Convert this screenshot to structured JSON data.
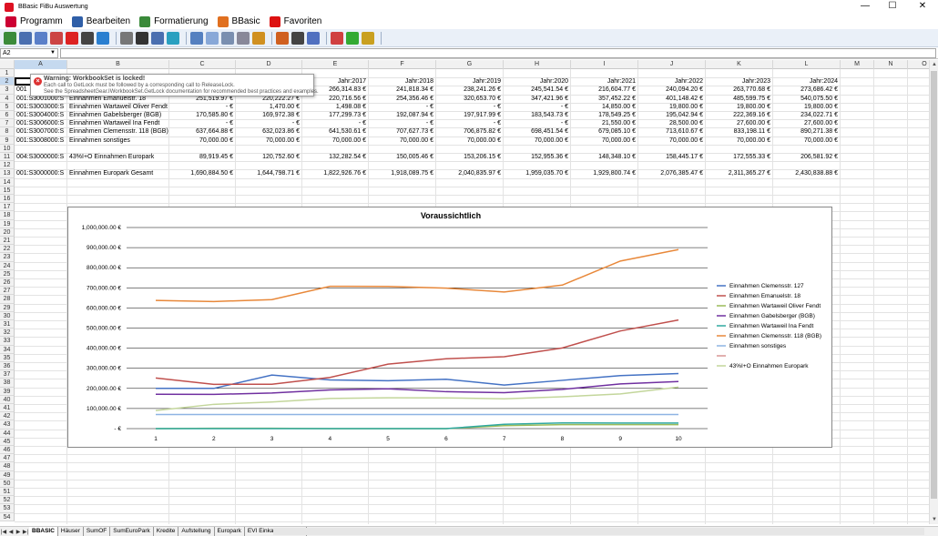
{
  "window": {
    "title": "BBasic FiBu Auswertung",
    "minimize": "—",
    "maximize": "☐",
    "close": "✕"
  },
  "menu": [
    {
      "label": "Programm",
      "icon": "programm-icon",
      "color": "#c03"
    },
    {
      "label": "Bearbeiten",
      "icon": "edit-icon",
      "color": "#2f5fa8"
    },
    {
      "label": "Formatierung",
      "icon": "format-icon",
      "color": "#3a8a3a"
    },
    {
      "label": "BBasic",
      "icon": "bbasic-icon",
      "color": "#e07020"
    },
    {
      "label": "Favoriten",
      "icon": "star-icon",
      "color": "#d11"
    }
  ],
  "formula": {
    "namebox": "A2",
    "value": ""
  },
  "columns": [
    "A",
    "B",
    "C",
    "D",
    "E",
    "F",
    "G",
    "H",
    "I",
    "J",
    "K",
    "L",
    "M",
    "N",
    "O"
  ],
  "rows": [
    "1",
    "2",
    "3",
    "4",
    "5",
    "6",
    "7",
    "8",
    "9",
    "10",
    "11",
    "12",
    "13",
    "14",
    "15",
    "16",
    "17",
    "18",
    "19",
    "20",
    "21",
    "22",
    "23",
    "24",
    "25",
    "26",
    "27",
    "28",
    "29",
    "30",
    "31",
    "32",
    "33",
    "34",
    "35",
    "36",
    "37",
    "38",
    "39",
    "40",
    "41",
    "42",
    "43",
    "44",
    "45",
    "46",
    "47",
    "48",
    "49",
    "50",
    "51",
    "52",
    "53",
    "54"
  ],
  "header_row": {
    "E": "Jahr:2017",
    "F": "Jahr:2018",
    "G": "Jahr:2019",
    "H": "Jahr:2020",
    "I": "Jahr:2021",
    "J": "Jahr:2022",
    "K": "Jahr:2023",
    "L": "Jahr:2024"
  },
  "table": [
    {
      "row": 3,
      "A": "001",
      "B": "",
      "C": "",
      "D": "",
      "E": "266,314.83 €",
      "F": "241,818.34 €",
      "G": "238,241.26 €",
      "H": "245,541.54 €",
      "I": "216,604.77 €",
      "J": "240,094.20 €",
      "K": "263,770.68 €",
      "L": "273,686.42 €"
    },
    {
      "row": 4,
      "A": "001:S3001000:S",
      "B": "Einnahmen Emanuelstr. 18",
      "C": "251,519.97 €",
      "D": "220,222.27 €",
      "E": "220,716.56 €",
      "F": "254,356.46 €",
      "G": "320,653.70 €",
      "H": "347,421.96 €",
      "I": "357,452.22 €",
      "J": "401,148.42 €",
      "K": "485,599.75 €",
      "L": "540,075.50 €"
    },
    {
      "row": 5,
      "A": "001:S3003000:S",
      "B": "Einnahmen Wartaweil Oliver Fendt",
      "C": "-  €",
      "D": "1,470.00 €",
      "E": "1,498.08 €",
      "F": "-  €",
      "G": "-  €",
      "H": "-  €",
      "I": "14,850.00 €",
      "J": "19,800.00 €",
      "K": "19,800.00 €",
      "L": "19,800.00 €"
    },
    {
      "row": 6,
      "A": "001:S3004000:S",
      "B": "Einnahmen Gabelsberger (BGB)",
      "C": "170,585.80 €",
      "D": "169,972.38 €",
      "E": "177,299.73 €",
      "F": "192,087.94 €",
      "G": "197,917.99 €",
      "H": "183,543.73 €",
      "I": "178,549.25 €",
      "J": "195,042.94 €",
      "K": "222,369.16 €",
      "L": "234,022.71 €"
    },
    {
      "row": 7,
      "A": "001:S3006000:S",
      "B": "Einnahmen Wartaweil Ina Fendt",
      "C": "-  €",
      "D": "-  €",
      "E": "-  €",
      "F": "-  €",
      "G": "-  €",
      "H": "-  €",
      "I": "21,550.00 €",
      "J": "28,500.00 €",
      "K": "27,600.00 €",
      "L": "27,600.00 €"
    },
    {
      "row": 8,
      "A": "001:S3007000:S",
      "B": "Einnahmen Clemensstr. 118 (BGB)",
      "C": "637,664.88 €",
      "D": "632,023.86 €",
      "E": "641,530.61 €",
      "F": "707,627.73 €",
      "G": "706,875.82 €",
      "H": "698,451.54 €",
      "I": "679,085.10 €",
      "J": "713,610.67 €",
      "K": "833,198.11 €",
      "L": "890,271.38 €"
    },
    {
      "row": 9,
      "A": "001:S3008000:S",
      "B": "Einnahmen sonstiges",
      "C": "70,000.00 €",
      "D": "70,000.00 €",
      "E": "70,000.00 €",
      "F": "70,000.00 €",
      "G": "70,000.00 €",
      "H": "70,000.00 €",
      "I": "70,000.00 €",
      "J": "70,000.00 €",
      "K": "70,000.00 €",
      "L": "70,000.00 €"
    },
    {
      "row": 11,
      "A": "004:S3000000:S",
      "B": "43%I+O Einnahmen Europark",
      "C": "89,919.45 €",
      "D": "120,752.60 €",
      "E": "132,282.54 €",
      "F": "150,005.46 €",
      "G": "153,206.15 €",
      "H": "152,955.36 €",
      "I": "148,348.10 €",
      "J": "158,445.17 €",
      "K": "172,555.33 €",
      "L": "206,581.92 €"
    },
    {
      "row": 13,
      "A": "001:S3000000:S",
      "B": "Einnahmen Europark Gesamt",
      "C": "1,690,884.50 €",
      "D": "1,644,798.71 €",
      "E": "1,822,926.76 €",
      "F": "1,918,089.75 €",
      "G": "2,040,835.97 €",
      "H": "1,959,035.70 €",
      "I": "1,929,800.74 €",
      "J": "2,076,385.47 €",
      "K": "2,311,365.27 €",
      "L": "2,430,838.88 €"
    }
  ],
  "warning": {
    "title": "Warning: WorkbookSet is locked!",
    "line1": "Each call to GetLock must be followed by a corresponding call to ReleaseLock.",
    "line2": "See the SpreadsheetGear.IWorkbookSet.GetLock documentation for recommended best practices and examples."
  },
  "chart_data": {
    "type": "line",
    "title": "Voraussichtlich",
    "x": [
      1,
      2,
      3,
      4,
      5,
      6,
      7,
      8,
      9,
      10
    ],
    "xlabel": "",
    "ylabel": "",
    "ylim": [
      0,
      1000000
    ],
    "yticks": [
      "-  €",
      "100,000.00 €",
      "200,000.00 €",
      "300,000.00 €",
      "400,000.00 €",
      "500,000.00 €",
      "600,000.00 €",
      "700,000.00 €",
      "800,000.00 €",
      "900,000.00 €",
      "1,000,000.00 €"
    ],
    "grid": true,
    "legend_position": "right",
    "series": [
      {
        "name": "Einnahmen Clemensstr. 127",
        "color": "#4472c4",
        "values": [
          200000,
          200000,
          266315,
          241818,
          238241,
          245542,
          216605,
          240094,
          263771,
          273686
        ]
      },
      {
        "name": "Einnahmen Emanuelstr. 18",
        "color": "#c0504d",
        "values": [
          251520,
          220222,
          220717,
          254356,
          320654,
          347422,
          357452,
          401148,
          485600,
          540076
        ]
      },
      {
        "name": "Einnahmen Wartaweil Oliver Fendt",
        "color": "#9bbb59",
        "values": [
          0,
          1470,
          1498,
          0,
          0,
          0,
          14850,
          19800,
          19800,
          19800
        ]
      },
      {
        "name": "Einnahmen Gabelsberger (BGB)",
        "color": "#7030a0",
        "values": [
          170586,
          169972,
          177300,
          192088,
          197918,
          183544,
          178549,
          195043,
          222369,
          234023
        ]
      },
      {
        "name": "Einnahmen Wartaweil Ina Fendt",
        "color": "#2fa8a0",
        "values": [
          0,
          0,
          0,
          0,
          0,
          0,
          21550,
          28500,
          27600,
          27600
        ]
      },
      {
        "name": "Einnahmen Clemensstr. 118 (BGB)",
        "color": "#e8883a",
        "values": [
          637665,
          632024,
          641531,
          707628,
          706876,
          698452,
          679085,
          713611,
          833198,
          890271
        ]
      },
      {
        "name": "Einnahmen sonstiges",
        "color": "#8eb4e3",
        "values": [
          70000,
          70000,
          70000,
          70000,
          70000,
          70000,
          70000,
          70000,
          70000,
          70000
        ]
      },
      {
        "name": "",
        "color": "#d99694",
        "values": []
      },
      {
        "name": "43%I+O Einnahmen Europark",
        "color": "#c3d69b",
        "values": [
          89919,
          120753,
          132283,
          150005,
          153206,
          152955,
          148348,
          158445,
          172555,
          206582
        ]
      }
    ]
  },
  "sheets": [
    "BBASIC",
    "Häuser",
    "SumOF",
    "SumEuroPark",
    "Kredite",
    "Aufstellung",
    "Europark",
    "EVI Einkaufsverbund"
  ],
  "active_sheet": "BBASIC"
}
